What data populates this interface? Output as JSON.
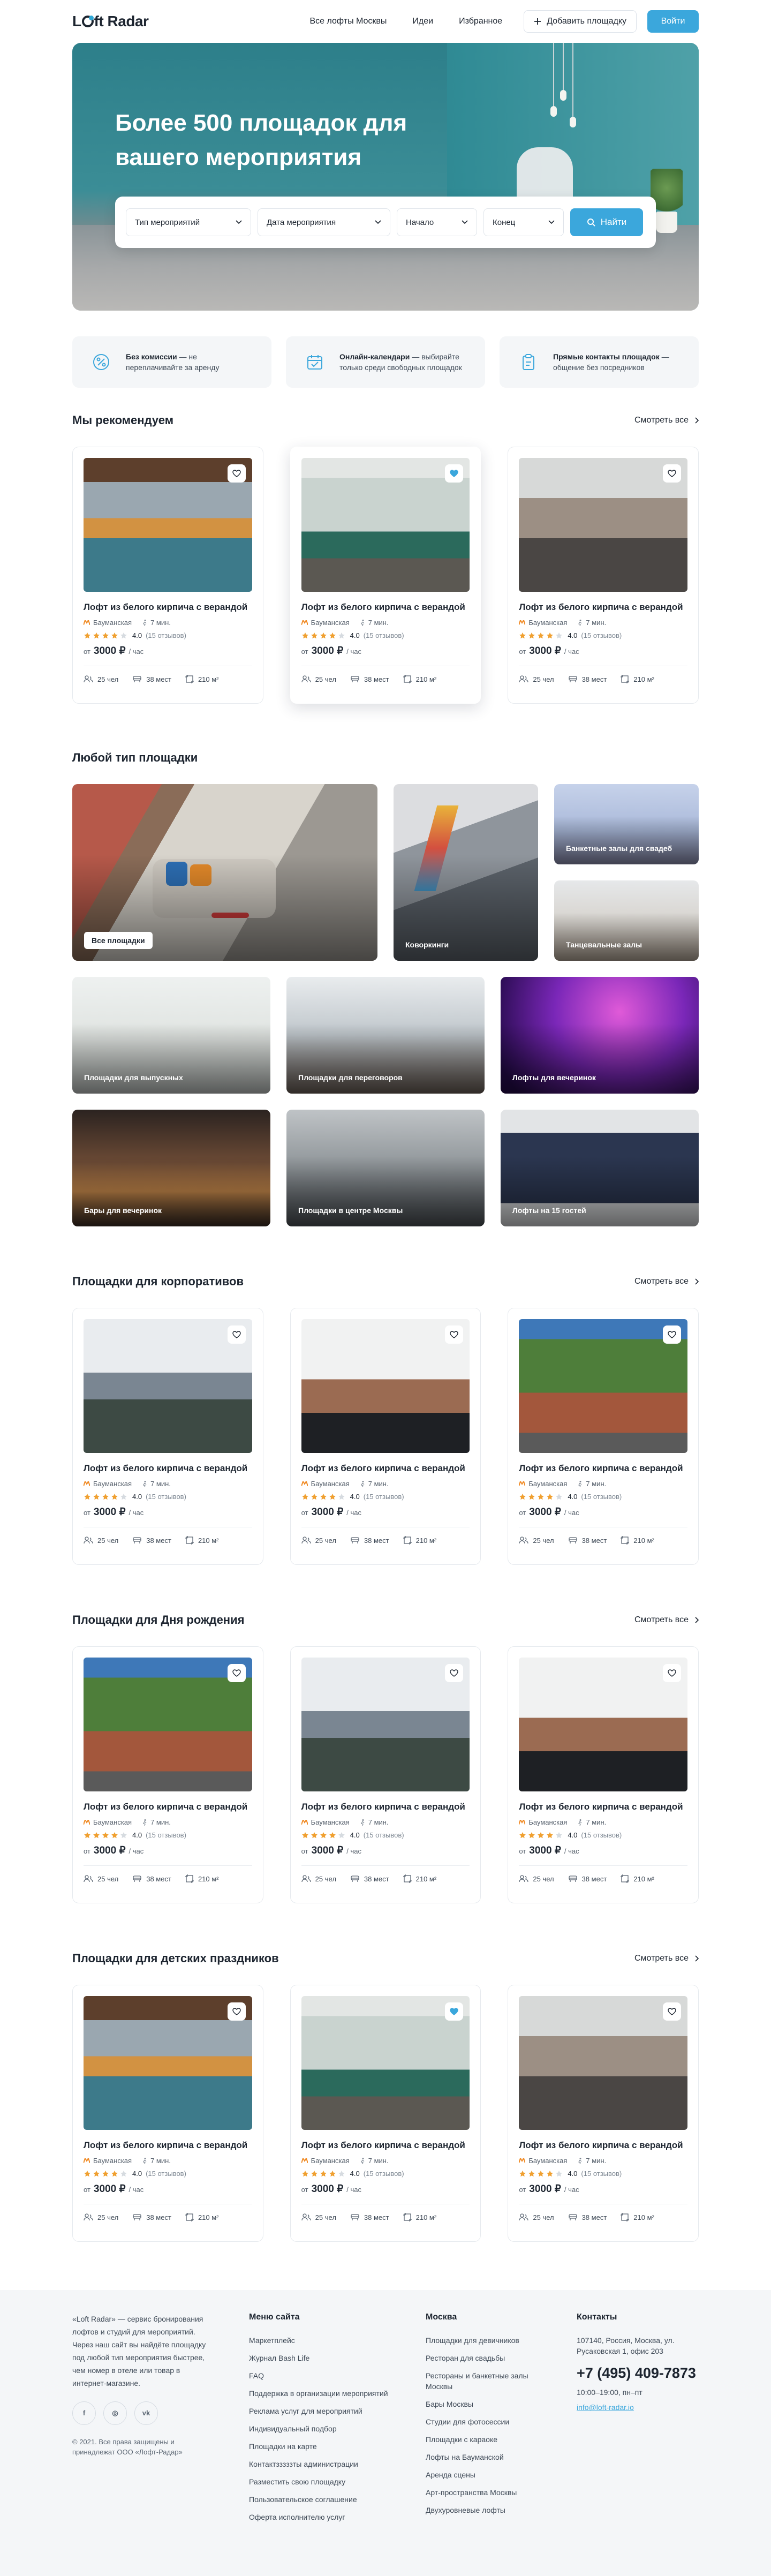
{
  "header": {
    "logo": "Loft Radar",
    "nav": [
      "Все лофты Москвы",
      "Идеи",
      "Избранное"
    ],
    "add_button": "Добавить площадку",
    "login_button": "Войти"
  },
  "hero": {
    "title": "Более 500 площадок для вашего мероприятия",
    "filters": [
      "Тип мероприятий",
      "Дата мероприятия",
      "Начало",
      "Конец"
    ],
    "search_button": "Найти"
  },
  "benefits": [
    {
      "icon": "percent-badge-icon",
      "bold": "Без комиссии",
      "text": " — не переплачивайте за аренду"
    },
    {
      "icon": "calendar-icon",
      "bold": "Онлайн-календари",
      "text": " — выбирайте только среди свободных площадок"
    },
    {
      "icon": "clipboard-icon",
      "bold": "Прямые контакты площадок",
      "text": " — общение без посредников"
    }
  ],
  "see_all": "Смотреть все",
  "card_template": {
    "title": "Лофт из белого кирпича с верандой",
    "metro": "Бауманская",
    "walk": "7 мин.",
    "rating": "4.0",
    "reviews": "(15 отзывов)",
    "price_prefix": "от",
    "price": "3000 ₽",
    "price_unit": "/ час",
    "people": "25 чел",
    "seats": "38 мест",
    "area": "210 м²"
  },
  "colors": {
    "accent": "#3ba7dc",
    "star": "#f0a030",
    "metro": "#f08a24"
  },
  "sections": [
    {
      "key": "recommend",
      "title": "Мы рекомендуем",
      "favs": [
        false,
        true,
        false
      ],
      "raised": 1,
      "images": [
        "cafe",
        "office-window",
        "hall-chairs"
      ]
    },
    {
      "key": "corporate",
      "title": "Площадки для корпоративов",
      "favs": [
        false,
        false,
        false
      ],
      "raised": -1,
      "images": [
        "coworking",
        "hall-brick-floor",
        "green-facade"
      ]
    },
    {
      "key": "birthday",
      "title": "Площадки для Дня рождения",
      "favs": [
        false,
        false,
        false
      ],
      "raised": -1,
      "images": [
        "green-facade",
        "coworking",
        "hall-brick-floor"
      ]
    },
    {
      "key": "kids",
      "title": "Площадки для детских праздников",
      "favs": [
        false,
        true,
        false
      ],
      "raised": -1,
      "images": [
        "cafe",
        "office-window",
        "hall-chairs"
      ]
    }
  ],
  "types": {
    "title": "Любой тип площадки",
    "big": "Все площадки",
    "tall": "Коворкинги",
    "small": [
      "Банкетные залы для свадеб",
      "Танцевальные залы"
    ],
    "row2": [
      "Площадки для выпускных",
      "Площадки для переговоров",
      "Лофты для вечеринок"
    ],
    "row3": [
      "Бары для вечеринок",
      "Площадки в центре Москвы",
      "Лофты на 15 гостей"
    ]
  },
  "footer": {
    "about": "«Loft Radar» — сервис бронирования лофтов и студий для мероприятий. Через наш сайт вы найдёте площадку под любой тип мероприятия быстрее, чем номер в отеле или товар в интернет-магазине.",
    "social": [
      "f",
      "◎",
      "vk"
    ],
    "copyright": "© 2021. Все права защищены и принадлежат ООО «Лофт-Радар»",
    "menu_title": "Меню сайта",
    "menu": [
      "Маркетплейс",
      "Журнал Bash Life",
      "FAQ",
      "Поддержка в организации мероприятий",
      "Реклама услуг для мероприятий",
      "Индивидуальный подбор",
      "Площадки на карте",
      "Контактзззззты администрации",
      "Разместить свою площадку",
      "Пользовательское соглашение",
      "Оферта исполнителю услуг"
    ],
    "moscow_title": "Москва",
    "moscow": [
      "Площадки для девичников",
      "Ресторан для свадьбы",
      "Рестораны и банкетные залы Москвы",
      "Бары Москвы",
      "Студии для фотосессии",
      "Площадки с караоке",
      "Лофты на Бауманской",
      "Аренда сцены",
      "Арт-пространства Москвы",
      "Двухуровневые лофты"
    ],
    "contacts_title": "Контакты",
    "address": "107140, Россия, Москва, ул. Русаковская 1, офис 203",
    "phone": "+7 (495) 409-7873",
    "hours": "10:00–19:00, пн–пт",
    "email": "info@loft-radar.io"
  }
}
